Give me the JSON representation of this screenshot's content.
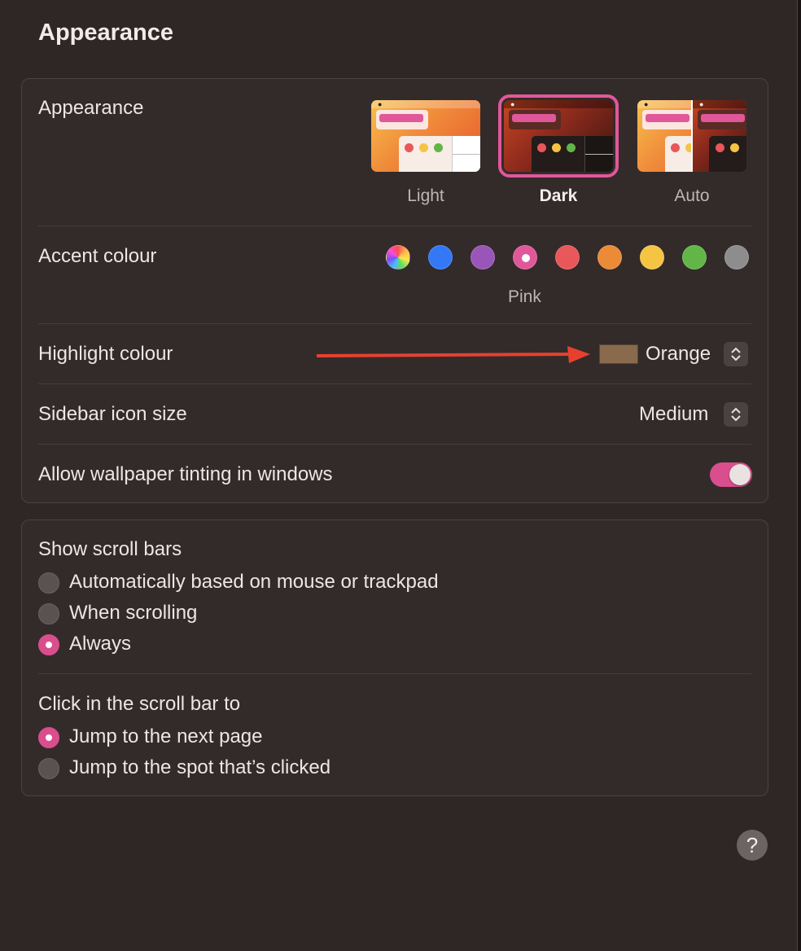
{
  "page": {
    "title": "Appearance"
  },
  "appearance_group": {
    "appearance_row": {
      "label": "Appearance",
      "options": [
        {
          "label": "Light",
          "selected": false
        },
        {
          "label": "Dark",
          "selected": true
        },
        {
          "label": "Auto",
          "selected": false
        }
      ]
    },
    "accent_row": {
      "label": "Accent colour",
      "selected_caption": "Pink",
      "swatches": [
        {
          "name": "multicolour",
          "color": "multicolor",
          "selected": false
        },
        {
          "name": "blue",
          "color": "#3478f6",
          "selected": false
        },
        {
          "name": "purple",
          "color": "#9a55b8",
          "selected": false
        },
        {
          "name": "pink",
          "color": "#e0589a",
          "selected": true
        },
        {
          "name": "red",
          "color": "#e8575a",
          "selected": false
        },
        {
          "name": "orange",
          "color": "#eb8a37",
          "selected": false
        },
        {
          "name": "yellow",
          "color": "#f6c443",
          "selected": false
        },
        {
          "name": "green",
          "color": "#62b547",
          "selected": false
        },
        {
          "name": "graphite",
          "color": "#8d8d8d",
          "selected": false
        }
      ]
    },
    "highlight_row": {
      "label": "Highlight colour",
      "value": "Orange",
      "chip_color": "#8a6a4c"
    },
    "sidebar_row": {
      "label": "Sidebar icon size",
      "value": "Medium"
    },
    "tinting_row": {
      "label": "Allow wallpaper tinting in windows",
      "enabled": true
    }
  },
  "scroll_group": {
    "show_scroll_bars": {
      "label": "Show scroll bars",
      "options": [
        {
          "label": "Automatically based on mouse or trackpad",
          "selected": false
        },
        {
          "label": "When scrolling",
          "selected": false
        },
        {
          "label": "Always",
          "selected": true
        }
      ]
    },
    "click_scroll_bar": {
      "label": "Click in the scroll bar to",
      "options": [
        {
          "label": "Jump to the next page",
          "selected": true
        },
        {
          "label": "Jump to the spot that’s clicked",
          "selected": false
        }
      ]
    }
  },
  "help": {
    "label": "?"
  },
  "annotation": {
    "arrow_color": "#e8402f"
  }
}
